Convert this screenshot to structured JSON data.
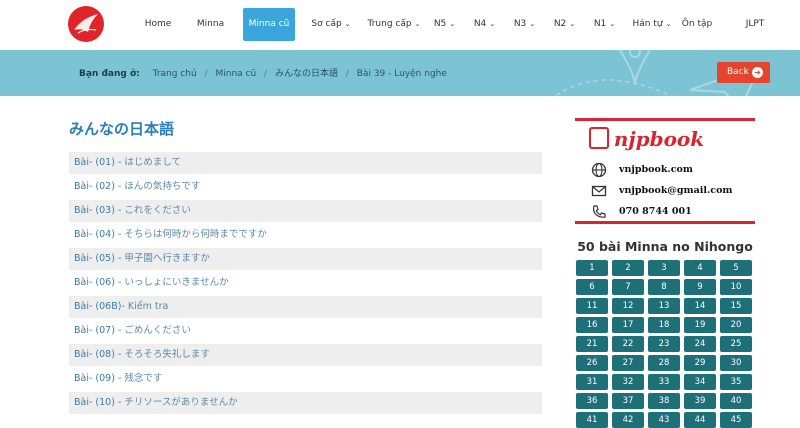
{
  "nav": {
    "items": [
      {
        "label": "Home",
        "dropdown": false,
        "active": false
      },
      {
        "label": "Minna",
        "dropdown": false,
        "active": false
      },
      {
        "label": "Minna cũ",
        "dropdown": false,
        "active": true
      },
      {
        "label": "Sơ cấp",
        "dropdown": true,
        "active": false
      },
      {
        "label": "Trung cấp",
        "dropdown": true,
        "active": false
      },
      {
        "label": "N5",
        "dropdown": true,
        "active": false
      },
      {
        "label": "N4",
        "dropdown": true,
        "active": false
      },
      {
        "label": "N3",
        "dropdown": true,
        "active": false
      },
      {
        "label": "N2",
        "dropdown": true,
        "active": false
      },
      {
        "label": "N1",
        "dropdown": true,
        "active": false
      },
      {
        "label": "Hán tự",
        "dropdown": true,
        "active": false
      },
      {
        "label": "Ôn tập",
        "dropdown": false,
        "active": false
      },
      {
        "label": "JLPT",
        "dropdown": false,
        "active": false
      }
    ]
  },
  "breadcrumb": {
    "prefix": "Bạn đang ở:",
    "items": [
      "Trang chủ",
      "Minna cũ",
      "みんなの日本語",
      "Bài 39 - Luyện nghe"
    ]
  },
  "back_button": {
    "label": "Back"
  },
  "main": {
    "title": "みんなの日本語",
    "lessons": [
      {
        "code": "Bài- (01) - ",
        "title": "はじめまして"
      },
      {
        "code": "Bài- (02) - ",
        "title": "ほんの気持ちです"
      },
      {
        "code": "Bài- (03) - ",
        "title": "これをください"
      },
      {
        "code": "Bài- (04) - ",
        "title": "そちらは何時から何時までですか"
      },
      {
        "code": "Bài- (05) - ",
        "title": "甲子園へ行きますか"
      },
      {
        "code": "Bài- (06) - ",
        "title": "いっしょにいきませんか"
      },
      {
        "code": "Bài- (06B)- ",
        "title": "Kiểm tra"
      },
      {
        "code": "Bài- (07) - ",
        "title": "ごめんください"
      },
      {
        "code": "Bài- (08) - ",
        "title": "そろそろ失礼します"
      },
      {
        "code": "Bài- (09) - ",
        "title": "残念です"
      },
      {
        "code": "Bài- (10) - ",
        "title": "チリソースがありませんか"
      }
    ]
  },
  "sidebar": {
    "brand": "njpbook",
    "website": "vnjpbook.com",
    "email": "vnjpbook@gmail.com",
    "phone": "070 8744 001",
    "lessons_title": "50 bài Minna no Nihongo",
    "lesson_numbers": [
      "1",
      "2",
      "3",
      "4",
      "5",
      "6",
      "7",
      "8",
      "9",
      "10",
      "11",
      "12",
      "13",
      "14",
      "15",
      "16",
      "17",
      "18",
      "19",
      "20",
      "21",
      "22",
      "23",
      "24",
      "25",
      "26",
      "27",
      "28",
      "29",
      "30",
      "31",
      "32",
      "33",
      "34",
      "35",
      "36",
      "37",
      "38",
      "39",
      "40",
      "41",
      "42",
      "43",
      "44",
      "45"
    ]
  },
  "colors": {
    "accent": "#3aa6dc",
    "banner": "#7cc3d4",
    "back": "#e5452f",
    "grid": "#1d6f78",
    "brand_red": "#d62631",
    "link": "#3a7ca5"
  },
  "icons": {
    "website": "globe-icon",
    "email": "envelope-icon",
    "phone": "phone-icon",
    "back": "arrow-right-circle-icon",
    "logo": "crane-logo-icon"
  }
}
